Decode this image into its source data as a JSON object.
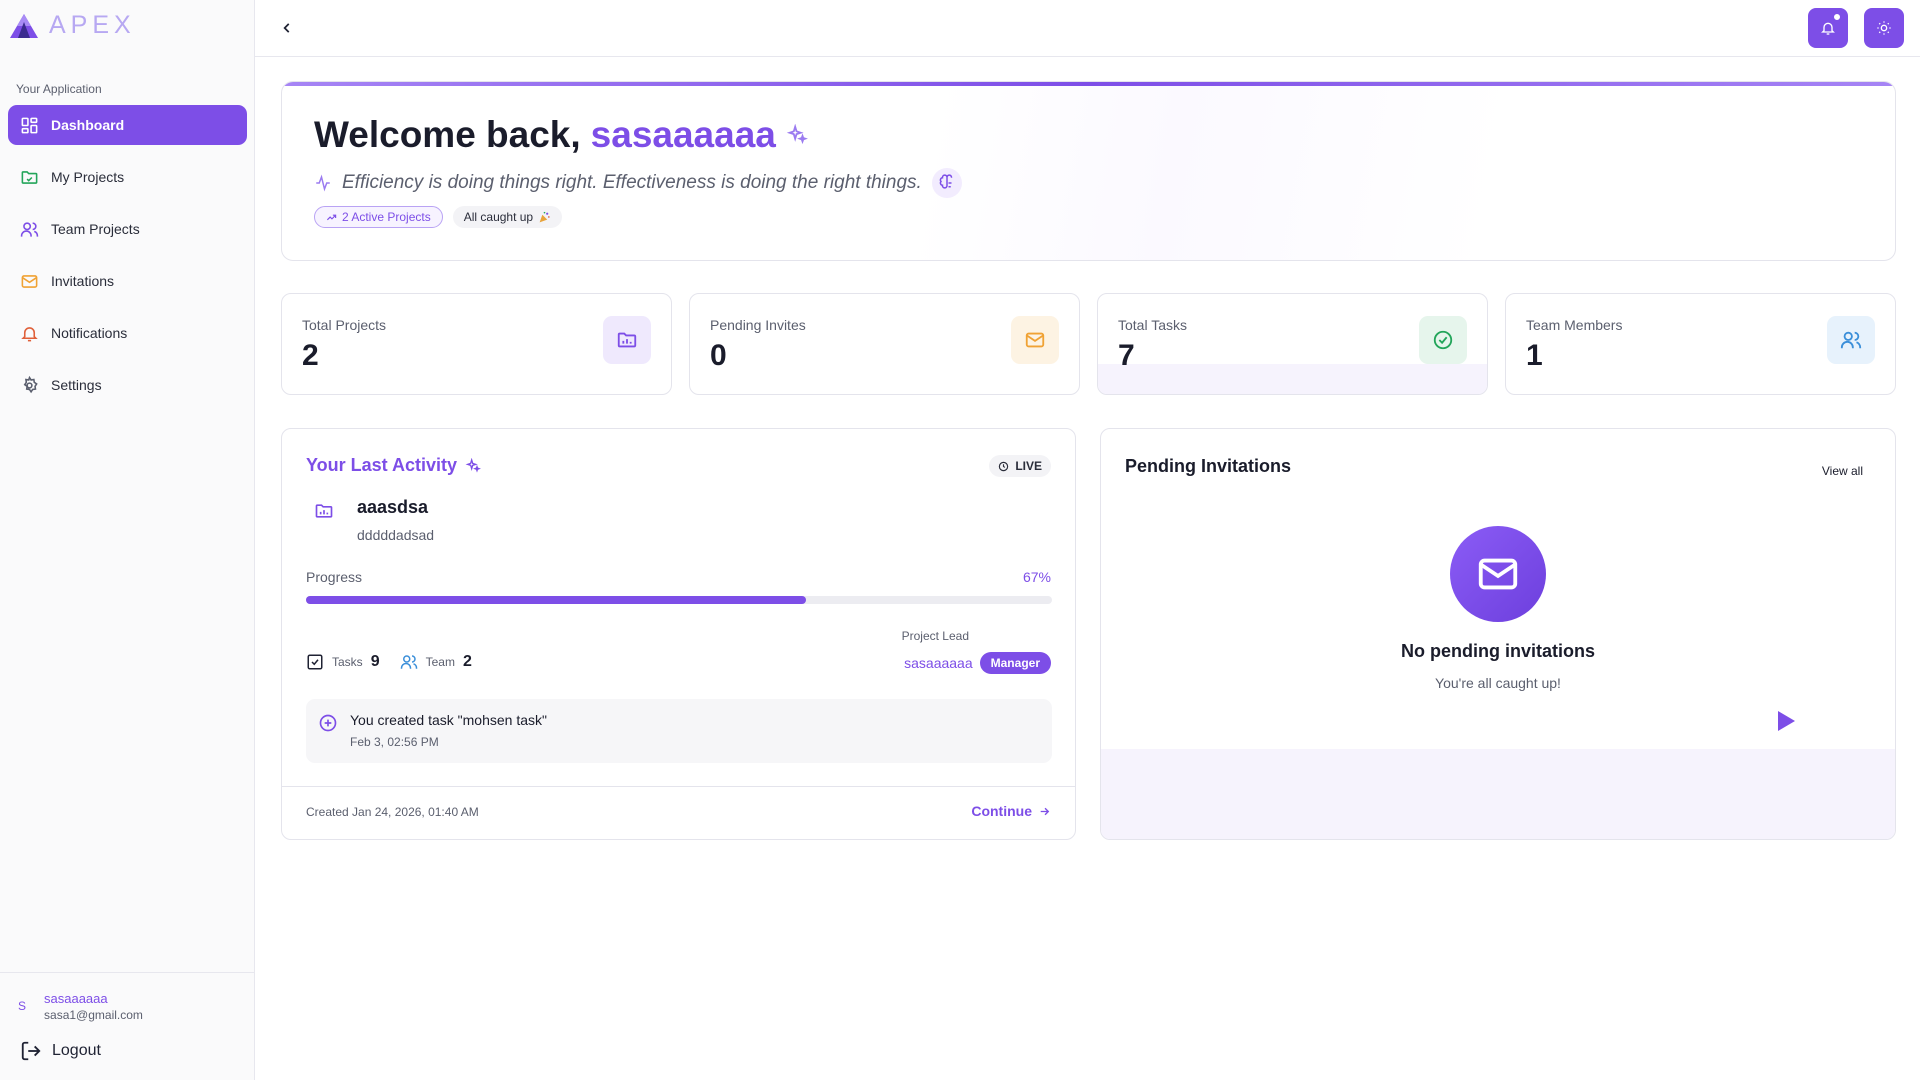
{
  "brand": {
    "name": "APEX"
  },
  "sidebar": {
    "section_label": "Your Application",
    "items": [
      {
        "label": "Dashboard",
        "icon": "dashboard-icon",
        "active": true
      },
      {
        "label": "My Projects",
        "icon": "folder-icon"
      },
      {
        "label": "Team Projects",
        "icon": "users-icon"
      },
      {
        "label": "Invitations",
        "icon": "mail-icon"
      },
      {
        "label": "Notifications",
        "icon": "bell-icon"
      },
      {
        "label": "Settings",
        "icon": "gear-icon"
      }
    ],
    "user": {
      "avatar": "S",
      "name": "sasaaaaaa",
      "email": "sasa1@gmail.com"
    },
    "logout_label": "Logout"
  },
  "welcome": {
    "greeting": "Welcome back,",
    "username": "sasaaaaaa",
    "quote": "Efficiency is doing things right. Effectiveness is doing the right things.",
    "chip_active": "2 Active Projects",
    "chip_caught": "All caught up"
  },
  "stats": [
    {
      "label": "Total Projects",
      "value": "2",
      "color": "#7d4ee7"
    },
    {
      "label": "Pending Invites",
      "value": "0",
      "color": "#f0a234"
    },
    {
      "label": "Total Tasks",
      "value": "7",
      "color": "#23a55a"
    },
    {
      "label": "Team Members",
      "value": "1",
      "color": "#3b8fd9"
    }
  ],
  "activity": {
    "title": "Your Last Activity",
    "live": "LIVE",
    "project_name": "aaasdsa",
    "project_desc": "dddddadsad",
    "progress_label": "Progress",
    "progress_pct": "67%",
    "progress_value": 0.67,
    "tasks_label": "Tasks",
    "tasks_count": "9",
    "team_label": "Team",
    "team_count": "2",
    "lead_label": "Project Lead",
    "lead_name": "sasaaaaaa",
    "lead_role": "Manager",
    "event_text": "You created task \"mohsen task\"",
    "event_time": "Feb 3, 02:56 PM",
    "created": "Created Jan 24, 2026, 01:40 AM",
    "continue_label": "Continue"
  },
  "pending": {
    "title": "Pending Invitations",
    "view_all": "View all",
    "empty_title": "No pending invitations",
    "empty_sub": "You're all caught up!"
  },
  "colors": {
    "accent": "#7d4ee7"
  }
}
